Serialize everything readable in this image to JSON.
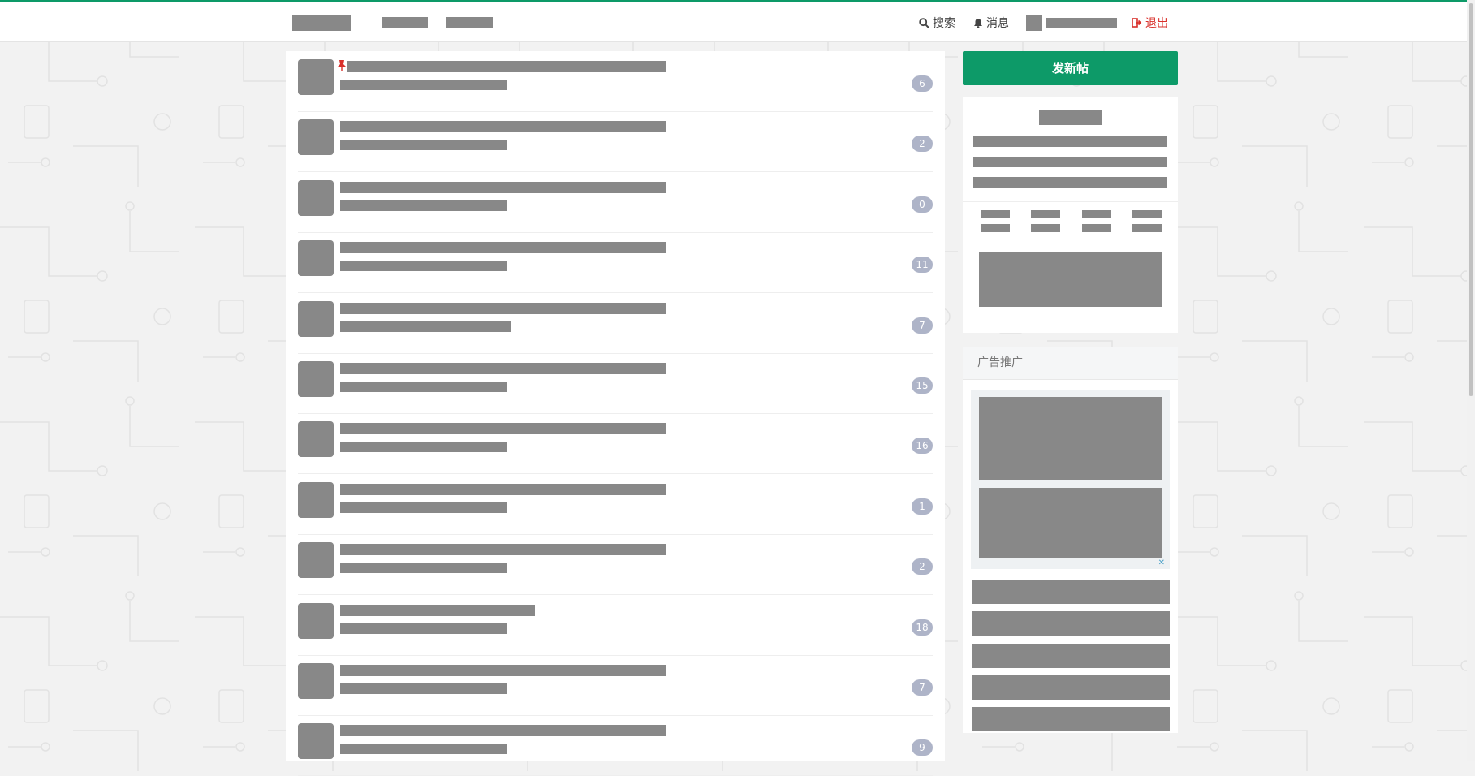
{
  "navbar": {
    "search_label": "搜索",
    "messages_label": "消息",
    "logout_label": "退出"
  },
  "threads": [
    {
      "count": "6",
      "pinned": true
    },
    {
      "count": "2"
    },
    {
      "count": "0"
    },
    {
      "count": "11"
    },
    {
      "count": "7"
    },
    {
      "count": "15"
    },
    {
      "count": "16"
    },
    {
      "count": "1"
    },
    {
      "count": "2"
    },
    {
      "count": "18"
    },
    {
      "count": "7"
    },
    {
      "count": "9"
    }
  ],
  "sidebar": {
    "new_post_label": "发新帖",
    "ad_title": "广告推广",
    "ad_close": "✕"
  },
  "colors": {
    "brand_green": "#0d9a68",
    "logout_red": "#d9302b",
    "badge": "#aeb4c8",
    "redacted": "#888888"
  }
}
